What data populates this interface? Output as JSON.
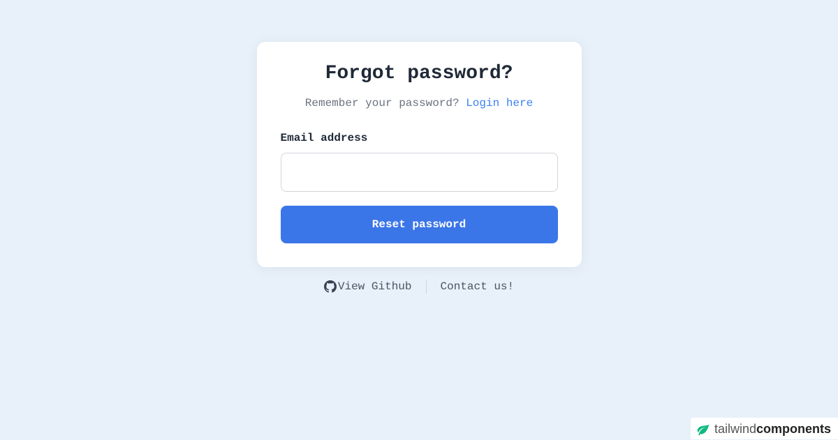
{
  "card": {
    "title": "Forgot password?",
    "subtitle_prefix": "Remember your password? ",
    "login_link": "Login here",
    "email_label": "Email address",
    "email_value": "",
    "reset_button": "Reset password"
  },
  "footer": {
    "github_link": "View Github",
    "contact_link": "Contact us!"
  },
  "brand": {
    "text_light": "tailwind",
    "text_bold": "components"
  }
}
